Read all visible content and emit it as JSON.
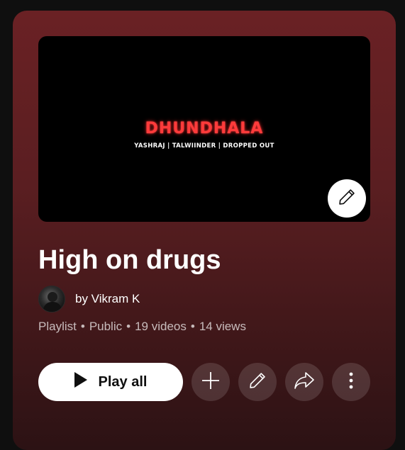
{
  "thumbnail": {
    "title": "DHUNDHALA",
    "subtitle": "YASHRAJ | TALWIINDER | DROPPED OUT",
    "edit_icon": "pencil-icon"
  },
  "playlist": {
    "title": "High on drugs",
    "owner": "by Vikram K",
    "type": "Playlist",
    "privacy": "Public",
    "video_count": "19 videos",
    "view_count": "14 views",
    "separator": "•"
  },
  "actions": {
    "play_all_label": "Play all",
    "play_icon": "play-icon",
    "add_icon": "plus-icon",
    "edit_icon": "pencil-icon",
    "share_icon": "share-icon",
    "more_icon": "more-vertical-icon"
  },
  "colors": {
    "panel_top": "#6a2124",
    "panel_bottom": "#2c1214",
    "thumbnail_title": "#ff3b3b",
    "primary_button_bg": "#ffffff",
    "secondary_button_bg": "rgba(255,255,255,0.13)"
  }
}
